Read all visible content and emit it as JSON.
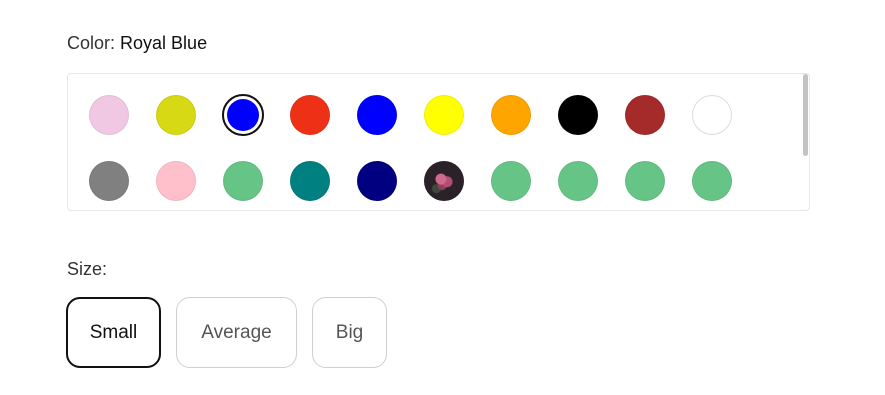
{
  "color": {
    "label": "Color:",
    "selected_value": "Royal Blue"
  },
  "swatches": [
    {
      "name": "swatch-lavender-pink",
      "color": "#f1c8e4",
      "selected": false
    },
    {
      "name": "swatch-chartreuse",
      "color": "#d6d913",
      "selected": false
    },
    {
      "name": "swatch-royal-blue",
      "color": "#0000ff",
      "selected": true
    },
    {
      "name": "swatch-red",
      "color": "#ee3116",
      "selected": false
    },
    {
      "name": "swatch-blue",
      "color": "#0000ff",
      "selected": false
    },
    {
      "name": "swatch-yellow",
      "color": "#ffff00",
      "selected": false
    },
    {
      "name": "swatch-orange",
      "color": "#ffa500",
      "selected": false
    },
    {
      "name": "swatch-black",
      "color": "#000000",
      "selected": false
    },
    {
      "name": "swatch-brown-red",
      "color": "#a52a2a",
      "selected": false
    },
    {
      "name": "swatch-white",
      "color": "#ffffff",
      "selected": false
    },
    {
      "name": "swatch-gray",
      "color": "#808080",
      "selected": false
    },
    {
      "name": "swatch-pink",
      "color": "#ffc0cb",
      "selected": false
    },
    {
      "name": "swatch-green-1",
      "color": "#66c586",
      "selected": false
    },
    {
      "name": "swatch-teal",
      "color": "#008080",
      "selected": false
    },
    {
      "name": "swatch-navy",
      "color": "#000080",
      "selected": false
    },
    {
      "name": "swatch-flower-image",
      "color": "image",
      "selected": false
    },
    {
      "name": "swatch-green-2",
      "color": "#66c586",
      "selected": false
    },
    {
      "name": "swatch-green-3",
      "color": "#66c586",
      "selected": false
    },
    {
      "name": "swatch-green-4",
      "color": "#66c586",
      "selected": false
    },
    {
      "name": "swatch-green-5",
      "color": "#66c586",
      "selected": false
    }
  ],
  "size": {
    "label": "Size:",
    "options": [
      "Small",
      "Average",
      "Big"
    ],
    "selected": "Small"
  }
}
